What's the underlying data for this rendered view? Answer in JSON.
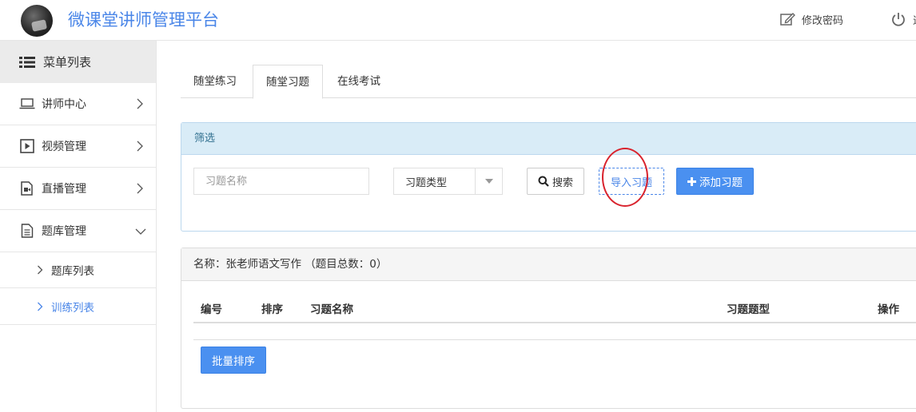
{
  "header": {
    "brand_title": "微课堂讲师管理平台",
    "change_password": "修改密码",
    "logout": "退"
  },
  "sidebar": {
    "menu_title": "菜单列表",
    "items": [
      {
        "label": "讲师中心",
        "icon": "laptop-icon"
      },
      {
        "label": "视频管理",
        "icon": "play-icon"
      },
      {
        "label": "直播管理",
        "icon": "live-icon"
      },
      {
        "label": "题库管理",
        "icon": "document-icon"
      }
    ],
    "subitems": [
      {
        "label": "题库列表"
      },
      {
        "label": "训练列表"
      }
    ]
  },
  "tabs": [
    "随堂练习",
    "随堂习题",
    "在线考试"
  ],
  "filter": {
    "title": "筛选",
    "name_placeholder": "习题名称",
    "type_select": "习题类型",
    "search_button": "搜索",
    "import_button": "导入习题",
    "add_button": "添加习题"
  },
  "list": {
    "heading": "名称：张老师语文写作 （题目总数：0）",
    "columns": [
      "编号",
      "排序",
      "习题名称",
      "习题题型",
      "操作"
    ],
    "batch_button": "批量排序"
  },
  "colors": {
    "brand": "#4a86e8",
    "primary_button": "#4a90f0",
    "filter_header_bg": "#d9ecf7",
    "annotation_circle": "#d9232d"
  }
}
